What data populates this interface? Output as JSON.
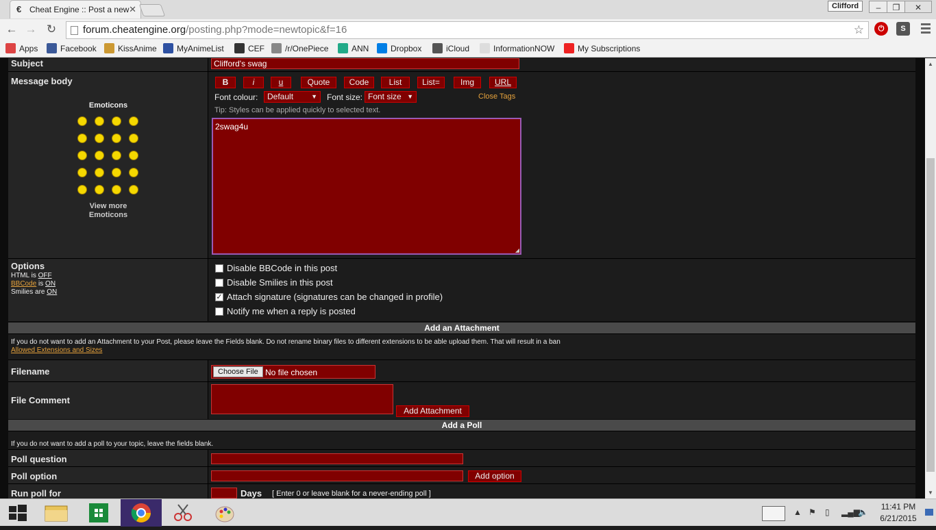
{
  "browser": {
    "tab_title": "Cheat Engine :: Post a new",
    "tab_icon": "€",
    "profile": "Clifford",
    "url_host": "forum.cheatengine.org",
    "url_path": "/posting.php?mode=newtopic&f=16"
  },
  "bookmarks": [
    {
      "label": "Apps",
      "color": "#d44"
    },
    {
      "label": "Facebook",
      "color": "#3b5998"
    },
    {
      "label": "KissAnime",
      "color": "#c93"
    },
    {
      "label": "MyAnimeList",
      "color": "#2e51a2"
    },
    {
      "label": "CEF",
      "color": "#333"
    },
    {
      "label": "/r/OnePiece",
      "color": "#888"
    },
    {
      "label": "ANN",
      "color": "#2a8"
    },
    {
      "label": "Dropbox",
      "color": "#007ee5"
    },
    {
      "label": "iCloud",
      "color": "#555"
    },
    {
      "label": "InformationNOW",
      "color": "#ddd"
    },
    {
      "label": "My Subscriptions",
      "color": "#e22"
    }
  ],
  "form": {
    "subject_label": "Subject",
    "subject_value": "Clifford's swag",
    "message_label": "Message body",
    "emoticons_title": "Emoticons",
    "view_more": "View more Emoticons",
    "buttons": [
      "B",
      "i",
      "u",
      "Quote",
      "Code",
      "List",
      "List=",
      "Img",
      "URL"
    ],
    "font_colour_label": "Font colour:",
    "font_colour_value": "Default",
    "font_size_label": "Font size:",
    "font_size_value": "Font size",
    "close_tags": "Close Tags",
    "tip": "Tip: Styles can be applied quickly to selected text.",
    "message_value": "2swag4u",
    "options_label": "Options",
    "html_status_prefix": "HTML is",
    "html_status": "OFF",
    "bbcode_link": "BBCode",
    "bbcode_is": "is",
    "bbcode_status": "ON",
    "smilies_prefix": "Smilies are",
    "smilies_status": "ON",
    "options": [
      {
        "label": "Disable BBCode in this post",
        "checked": false
      },
      {
        "label": "Disable Smilies in this post",
        "checked": false
      },
      {
        "label": "Attach signature (signatures can be changed in profile)",
        "checked": true
      },
      {
        "label": "Notify me when a reply is posted",
        "checked": false
      }
    ]
  },
  "attachment": {
    "header": "Add an Attachment",
    "info": "If you do not want to add an Attachment to your Post, please leave the Fields blank. Do not rename binary files to different extensions to be able upload them. That will result in a ban",
    "allowed_link": "Allowed Extensions and Sizes",
    "filename_label": "Filename",
    "choose_file": "Choose File",
    "no_file": "No file chosen",
    "comment_label": "File Comment",
    "add_button": "Add Attachment"
  },
  "poll": {
    "header": "Add a Poll",
    "info": "If you do not want to add a poll to your topic, leave the fields blank.",
    "question_label": "Poll question",
    "option_label": "Poll option",
    "add_option": "Add option",
    "run_label": "Run poll for",
    "days": "Days",
    "days_hint": "[ Enter 0 or leave blank for a never-ending poll ]"
  },
  "taskbar": {
    "time": "11:41 PM",
    "date": "6/21/2015"
  }
}
